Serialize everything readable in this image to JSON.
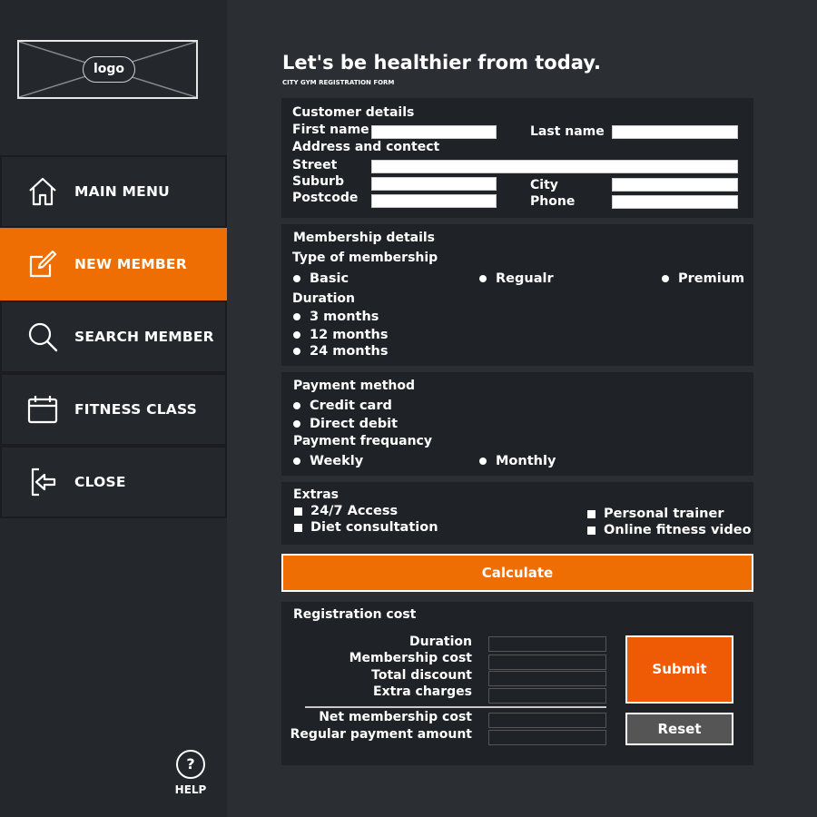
{
  "sidebar": {
    "logo_text": "logo",
    "items": [
      {
        "label": "MAIN MENU",
        "icon": "home-icon"
      },
      {
        "label": "NEW MEMBER",
        "icon": "edit-icon"
      },
      {
        "label": "SEARCH MEMBER",
        "icon": "search-icon"
      },
      {
        "label": "FITNESS CLASS",
        "icon": "calendar-icon"
      },
      {
        "label": "CLOSE",
        "icon": "logout-icon"
      }
    ],
    "active_index": 1,
    "help_symbol": "?",
    "help_label": "HELP"
  },
  "header": {
    "title": "Let's be healthier from today.",
    "subtitle": "CITY GYM REGISTRATION FORM"
  },
  "customer": {
    "heading": "Customer details",
    "first_name": "First name",
    "last_name": "Last name",
    "address_heading": "Address and contect",
    "street": "Street",
    "suburb": "Suburb",
    "postcode": "Postcode",
    "city": "City",
    "phone": "Phone"
  },
  "membership": {
    "heading": "Membership details",
    "type_heading": "Type of membership",
    "types": [
      "Basic",
      "Regualr",
      "Premium"
    ],
    "duration_heading": "Duration",
    "durations": [
      "3 months",
      "12 months",
      "24 months"
    ]
  },
  "payment": {
    "heading": "Payment method",
    "methods": [
      "Credit card",
      "Direct debit"
    ],
    "frequency_heading": "Payment frequancy",
    "frequencies": [
      "Weekly",
      "Monthly"
    ]
  },
  "extras": {
    "heading": "Extras",
    "items": [
      "24/7 Access",
      "Diet consultation",
      "Personal trainer",
      "Online fitness video"
    ]
  },
  "calculate_label": "Calculate",
  "cost": {
    "heading": "Registration cost",
    "rows": [
      "Duration",
      "Membership cost",
      "Total discount",
      "Extra charges",
      "Net membership cost",
      "Regular payment amount"
    ],
    "submit_label": "Submit",
    "reset_label": "Reset"
  },
  "colors": {
    "accent": "#ef6e03",
    "submit": "#ef5a05",
    "panel": "#1f2226",
    "sidebar": "#24272b",
    "background": "#2b2e32"
  }
}
